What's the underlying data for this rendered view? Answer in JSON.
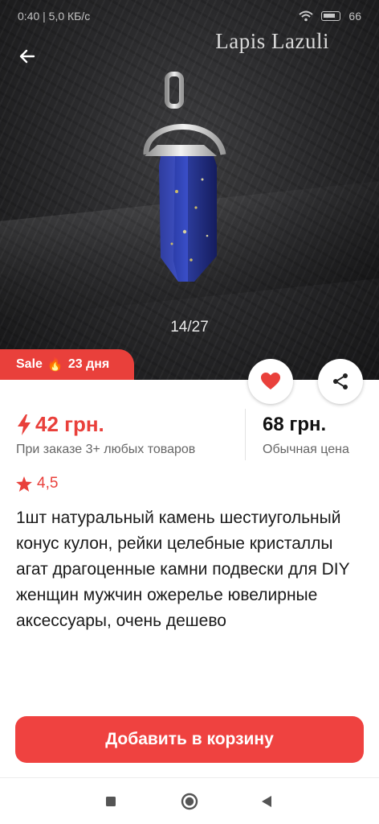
{
  "status_bar": {
    "time": "0:40",
    "speed": "5,0 КБ/с",
    "battery": "66"
  },
  "hero": {
    "watermark": "Lapis Lazuli",
    "counter": "14/27"
  },
  "sale_badge": {
    "label": "Sale",
    "days": "23 дня"
  },
  "price": {
    "promo_price": "42 грн.",
    "promo_note": "При заказе 3+ любых товаров",
    "regular_price": "68 грн.",
    "regular_note": "Обычная цена"
  },
  "rating": {
    "value": "4,5"
  },
  "product": {
    "title": "1шт натуральный камень шестиугольный конус кулон, рейки целебные кристаллы агат драгоценные камни подвески для DIY женщин мужчин ожерелье ювелирные аксессуары, очень дешево"
  },
  "actions": {
    "add_to_cart": "Добавить в корзину"
  },
  "colors": {
    "accent": "#e9403b",
    "button": "#ef4240"
  },
  "icons": {
    "back": "arrow-left-icon",
    "favorite": "heart-icon",
    "share": "share-icon",
    "promo": "lightning-icon",
    "rating": "star-icon",
    "sale": "flame-icon"
  }
}
